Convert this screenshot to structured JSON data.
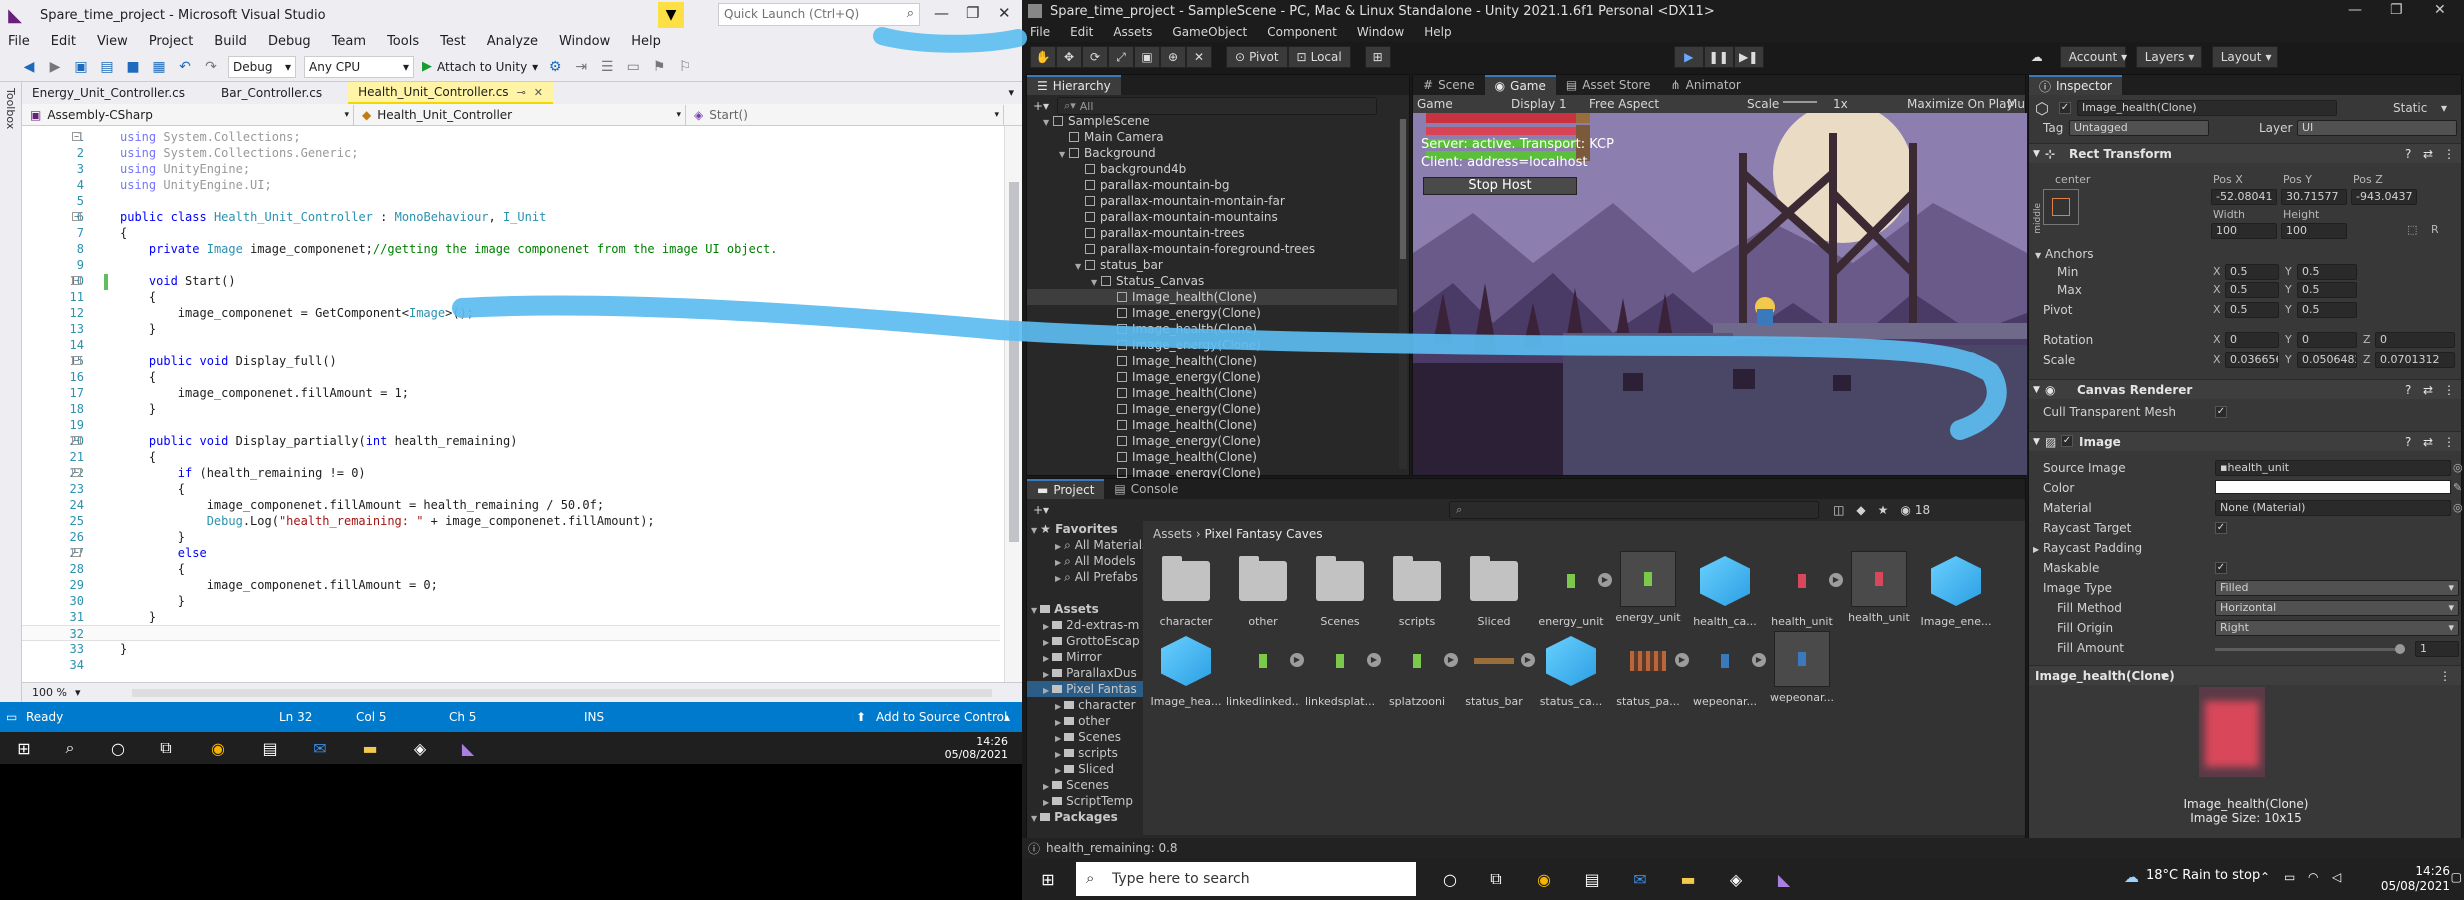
{
  "vs": {
    "title": "Spare_time_project - Microsoft Visual Studio",
    "quick_launch_placeholder": "Quick Launch (Ctrl+Q)",
    "menu": [
      "File",
      "Edit",
      "View",
      "Project",
      "Build",
      "Debug",
      "Team",
      "Tools",
      "Test",
      "Analyze",
      "Window",
      "Help"
    ],
    "toolbar": {
      "config": "Debug",
      "platform": "Any CPU",
      "attach": "Attach to Unity"
    },
    "toolbox_label": "Toolbox",
    "tabs": [
      "Energy_Unit_Controller.cs",
      "Bar_Controller.cs",
      "Health_Unit_Controller.cs"
    ],
    "nav": {
      "project": "Assembly-CSharp",
      "class": "Health_Unit_Controller",
      "member": "Start()"
    },
    "zoom": "100 %",
    "status": {
      "ready": "Ready",
      "ln": "Ln 32",
      "col": "Col 5",
      "ch": "Ch 5",
      "ins": "INS",
      "source_control": "Add to Source Control"
    }
  },
  "code": [
    {
      "n": "1",
      "t": "using System.Collections;"
    },
    {
      "n": "2",
      "t": "using System.Collections.Generic;"
    },
    {
      "n": "3",
      "t": "using UnityEngine;"
    },
    {
      "n": "4",
      "t": "using UnityEngine.UI;"
    },
    {
      "n": "5",
      "t": ""
    },
    {
      "n": "6",
      "t": "public class Health_Unit_Controller : MonoBehaviour, I_Unit"
    },
    {
      "n": "7",
      "t": "{"
    },
    {
      "n": "8",
      "t": "    private Image image_componenet;//getting the image componenet from the image UI object."
    },
    {
      "n": "9",
      "t": ""
    },
    {
      "n": "10",
      "t": "    void Start()"
    },
    {
      "n": "11",
      "t": "    {"
    },
    {
      "n": "12",
      "t": "        image_componenet = GetComponent<Image>();"
    },
    {
      "n": "13",
      "t": "    }"
    },
    {
      "n": "14",
      "t": ""
    },
    {
      "n": "15",
      "t": "    public void Display_full()"
    },
    {
      "n": "16",
      "t": "    {"
    },
    {
      "n": "17",
      "t": "        image_componenet.fillAmount = 1;"
    },
    {
      "n": "18",
      "t": "    }"
    },
    {
      "n": "19",
      "t": ""
    },
    {
      "n": "20",
      "t": "    public void Display_partially(int health_remaining)"
    },
    {
      "n": "21",
      "t": "    {"
    },
    {
      "n": "22",
      "t": "        if (health_remaining != 0)"
    },
    {
      "n": "23",
      "t": "        {"
    },
    {
      "n": "24",
      "t": "            image_componenet.fillAmount = health_remaining / 50.0f;"
    },
    {
      "n": "25",
      "t": "            Debug.Log(\"health_remaining: \" + image_componenet.fillAmount);"
    },
    {
      "n": "26",
      "t": "        }"
    },
    {
      "n": "27",
      "t": "        else"
    },
    {
      "n": "28",
      "t": "        {"
    },
    {
      "n": "29",
      "t": "            image_componenet.fillAmount = 0;"
    },
    {
      "n": "30",
      "t": "        }"
    },
    {
      "n": "31",
      "t": "    }"
    },
    {
      "n": "32",
      "t": ""
    },
    {
      "n": "33",
      "t": "}"
    },
    {
      "n": "34",
      "t": ""
    }
  ],
  "taskbar1": {
    "time": "14:26",
    "date": "05/08/2021"
  },
  "unity": {
    "title": "Spare_time_project - SampleScene - PC, Mac & Linux Standalone - Unity 2021.1.6f1 Personal <DX11>",
    "menu": [
      "File",
      "Edit",
      "Assets",
      "GameObject",
      "Component",
      "Window",
      "Help"
    ],
    "toolbar": {
      "pivot": "Pivot",
      "local": "Local",
      "account": "Account",
      "layers": "Layers",
      "layout": "Layout"
    },
    "hierarchy": {
      "tab": "Hierarchy",
      "search_placeholder": "All",
      "items": [
        {
          "label": "SampleScene",
          "indent": 1,
          "tri": "▼"
        },
        {
          "label": "Main Camera",
          "indent": 2,
          "tri": ""
        },
        {
          "label": "Background",
          "indent": 2,
          "tri": "▼"
        },
        {
          "label": "background4b",
          "indent": 3,
          "tri": ""
        },
        {
          "label": "parallax-mountain-bg",
          "indent": 3,
          "tri": ""
        },
        {
          "label": "parallax-mountain-montain-far",
          "indent": 3,
          "tri": ""
        },
        {
          "label": "parallax-mountain-mountains",
          "indent": 3,
          "tri": ""
        },
        {
          "label": "parallax-mountain-trees",
          "indent": 3,
          "tri": ""
        },
        {
          "label": "parallax-mountain-foreground-trees",
          "indent": 3,
          "tri": ""
        },
        {
          "label": "status_bar",
          "indent": 3,
          "tri": "▼"
        },
        {
          "label": "Status_Canvas",
          "indent": 4,
          "tri": "▼"
        },
        {
          "label": "Image_health(Clone)",
          "indent": 5,
          "tri": "",
          "sel": true
        },
        {
          "label": "Image_energy(Clone)",
          "indent": 5,
          "tri": ""
        },
        {
          "label": "Image_health(Clone)",
          "indent": 5,
          "tri": ""
        },
        {
          "label": "Image_energy(Clone)",
          "indent": 5,
          "tri": ""
        },
        {
          "label": "Image_health(Clone)",
          "indent": 5,
          "tri": ""
        },
        {
          "label": "Image_energy(Clone)",
          "indent": 5,
          "tri": ""
        },
        {
          "label": "Image_health(Clone)",
          "indent": 5,
          "tri": ""
        },
        {
          "label": "Image_energy(Clone)",
          "indent": 5,
          "tri": ""
        },
        {
          "label": "Image_health(Clone)",
          "indent": 5,
          "tri": ""
        },
        {
          "label": "Image_energy(Clone)",
          "indent": 5,
          "tri": ""
        },
        {
          "label": "Image_health(Clone)",
          "indent": 5,
          "tri": ""
        },
        {
          "label": "Image_energy(Clone)",
          "indent": 5,
          "tri": ""
        }
      ]
    },
    "game": {
      "tabs": [
        "Scene",
        "Game",
        "Asset Store",
        "Animator"
      ],
      "display": "Display 1",
      "aspect": "Free Aspect",
      "scale_label": "Scale",
      "scale_value": "1x",
      "maximize": "Maximize On Play",
      "mute": "Mu",
      "mode": "Game",
      "server_text": "Server: active. Transport: KCP",
      "client_text": "Client: address=localhost",
      "stop_host": "Stop Host"
    },
    "inspector": {
      "tab": "Inspector",
      "object_name": "Image_health(Clone)",
      "static": "Static",
      "tag_label": "Tag",
      "tag": "Untagged",
      "layer_label": "Layer",
      "layer": "UI",
      "rect_transform": "Rect Transform",
      "anchor_preset": "center",
      "middle_label": "middle",
      "pos_x_label": "Pos X",
      "pos_x": "-52.08041",
      "pos_y_label": "Pos Y",
      "pos_y": "30.71577",
      "pos_z_label": "Pos Z",
      "pos_z": "-943.0437",
      "width_label": "Width",
      "width": "100",
      "height_label": "Height",
      "height": "100",
      "anchors": "Anchors",
      "min": "Min",
      "min_x": "0.5",
      "min_y": "0.5",
      "max": "Max",
      "max_x": "0.5",
      "max_y": "0.5",
      "pivot": "Pivot",
      "pivot_x": "0.5",
      "pivot_y": "0.5",
      "rotation": "Rotation",
      "rot_x": "0",
      "rot_y": "0",
      "rot_z": "0",
      "scale": "Scale",
      "scale_x": "0.0366567",
      "scale_y": "0.0506482",
      "scale_z": "0.0701312",
      "x": "X",
      "y": "Y",
      "z": "Z",
      "canvas_renderer": "Canvas Renderer",
      "cull_mesh": "Cull Transparent Mesh",
      "image": "Image",
      "source_image_label": "Source Image",
      "source_image": "health_unit",
      "color_label": "Color",
      "material_label": "Material",
      "material": "None (Material)",
      "raycast_target": "Raycast Target",
      "raycast_padding": "Raycast Padding",
      "maskable": "Maskable",
      "image_type_label": "Image Type",
      "image_type": "Filled",
      "fill_method_label": "Fill Method",
      "fill_method": "Horizontal",
      "fill_origin_label": "Fill Origin",
      "fill_origin": "Right",
      "fill_amount_label": "Fill Amount",
      "fill_amount": "1",
      "fill_amount_fraction": 1,
      "preview_title": "Image_health(Clone)",
      "preview_name": "Image_health(Clone)",
      "preview_size": "Image Size: 10x15"
    },
    "project": {
      "tabs": [
        "Project",
        "Console"
      ],
      "badge": "18",
      "breadcrumb": [
        "Assets",
        "Pixel Fantasy Caves"
      ],
      "tree": [
        {
          "label": "Favorites",
          "indent": 0,
          "bold": true
        },
        {
          "label": "All Materials",
          "indent": 2
        },
        {
          "label": "All Models",
          "indent": 2
        },
        {
          "label": "All Prefabs",
          "indent": 2
        },
        {
          "label": "",
          "indent": 0
        },
        {
          "label": "Assets",
          "indent": 0,
          "bold": true
        },
        {
          "label": "2d-extras-m",
          "indent": 1
        },
        {
          "label": "GrottoEscap",
          "indent": 1
        },
        {
          "label": "Mirror",
          "indent": 1
        },
        {
          "label": "ParallaxDus",
          "indent": 1
        },
        {
          "label": "Pixel Fantas",
          "indent": 1,
          "sel": true
        },
        {
          "label": "character",
          "indent": 2
        },
        {
          "label": "other",
          "indent": 2
        },
        {
          "label": "Scenes",
          "indent": 2
        },
        {
          "label": "scripts",
          "indent": 2
        },
        {
          "label": "Sliced",
          "indent": 2
        },
        {
          "label": "Scenes",
          "indent": 1
        },
        {
          "label": "ScriptTemp",
          "indent": 1
        },
        {
          "label": "Packages",
          "indent": 0,
          "bold": true
        }
      ],
      "assets_row1": [
        {
          "label": "character",
          "kind": "folder"
        },
        {
          "label": "other",
          "kind": "folder"
        },
        {
          "label": "Scenes",
          "kind": "folder"
        },
        {
          "label": "scripts",
          "kind": "folder"
        },
        {
          "label": "Sliced",
          "kind": "folder"
        },
        {
          "label": "energy_unit",
          "kind": "sprite-green"
        },
        {
          "label": "energy_unit",
          "kind": "sprite-green-box"
        },
        {
          "label": "health_ca...",
          "kind": "cube"
        },
        {
          "label": "health_unit",
          "kind": "sprite-red"
        },
        {
          "label": "health_unit",
          "kind": "sprite-red-box"
        },
        {
          "label": "Image_ene...",
          "kind": "cube"
        }
      ],
      "assets_row2": [
        {
          "label": "Image_hea...",
          "kind": "cube"
        },
        {
          "label": "linkedlinked...",
          "kind": "sprite-green"
        },
        {
          "label": "linkedsplat...",
          "kind": "sprite-green"
        },
        {
          "label": "splatzooni",
          "kind": "sprite-green"
        },
        {
          "label": "status_bar",
          "kind": "sprite-bar"
        },
        {
          "label": "status_ca...",
          "kind": "cube"
        },
        {
          "label": "status_pa...",
          "kind": "sprite-orange"
        },
        {
          "label": "wepeonar...",
          "kind": "sprite-blue"
        },
        {
          "label": "wepeonar...",
          "kind": "sprite-blue-box"
        }
      ]
    },
    "status_log": "health_remaining: 0.8"
  },
  "taskbar2": {
    "search_placeholder": "Type here to search",
    "weather": "18°C  Rain to stop",
    "time": "14:26",
    "date": "05/08/2021"
  },
  "colors": {
    "vs_accent": "#007acc",
    "annotation_blue": "#5bbcf0",
    "unity_bg": "#282828"
  }
}
